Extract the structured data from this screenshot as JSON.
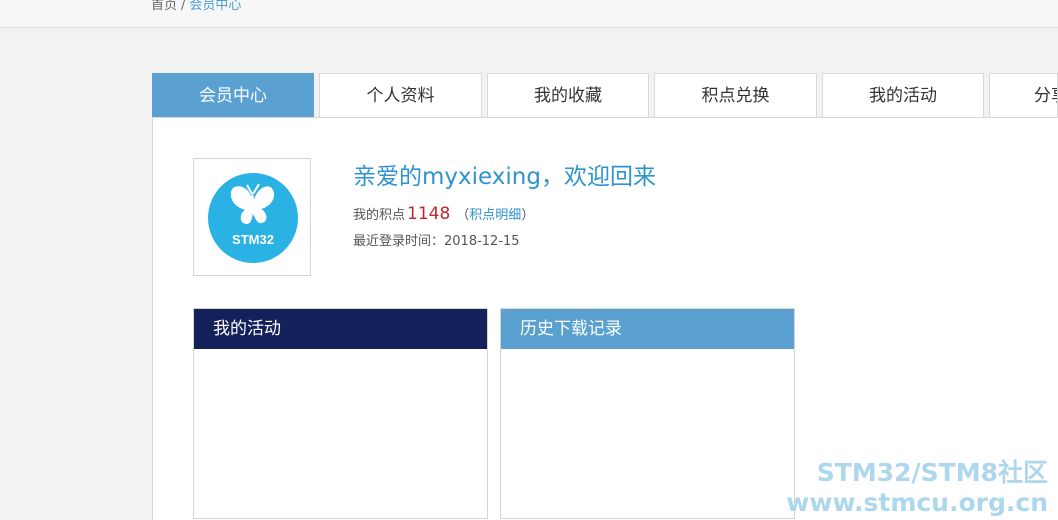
{
  "breadcrumb": {
    "home": "首页",
    "separator": "/",
    "current": "会员中心"
  },
  "tabs": [
    {
      "label": "会员中心",
      "active": true
    },
    {
      "label": "个人资料",
      "active": false
    },
    {
      "label": "我的收藏",
      "active": false
    },
    {
      "label": "积点兑换",
      "active": false
    },
    {
      "label": "我的活动",
      "active": false
    },
    {
      "label": "分享",
      "active": false
    }
  ],
  "profile": {
    "avatar_icon": "stm32-butterfly-logo",
    "avatar_text": "STM32",
    "welcome": "亲爱的myxiexing，欢迎回来",
    "points_label": "我的积点",
    "points_value": "1148",
    "points_detail_open": "（",
    "points_detail_link": "积点明细",
    "points_detail_close": "）",
    "last_login_label": "最近登录时间：",
    "last_login_value": "2018-12-15"
  },
  "boxes": {
    "activity_title": "我的活动",
    "downloads_title": "历史下载记录"
  },
  "watermark": {
    "line1": "STM32/STM8社区",
    "line2": "www.stmcu.org.cn"
  },
  "colors": {
    "accent": "#5aa0d0",
    "link": "#2f93cf",
    "points": "#c0272d",
    "activity_header": "#13215b"
  }
}
